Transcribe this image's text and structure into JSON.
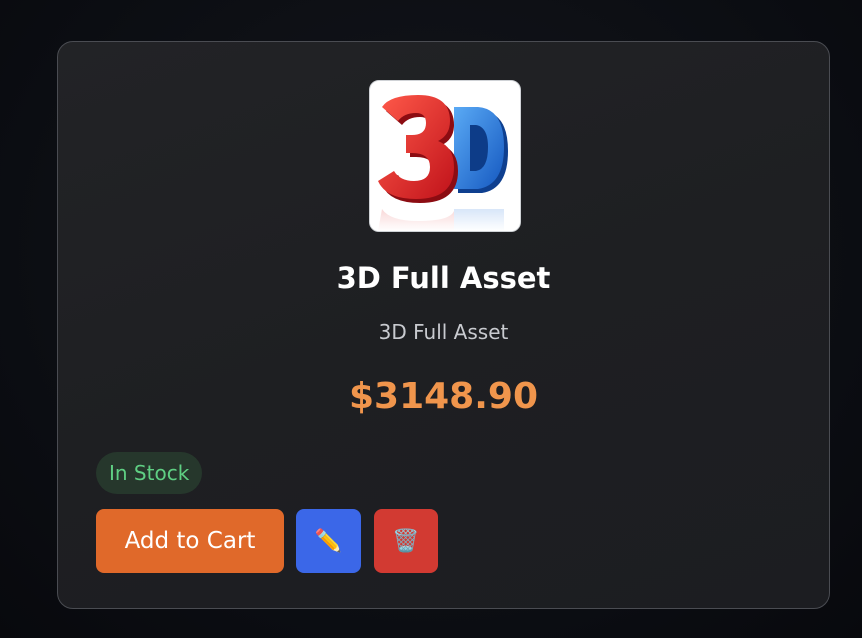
{
  "product": {
    "image_alt": "3D",
    "title": "3D Full Asset",
    "description": "3D Full Asset",
    "price": "$3148.90",
    "stock_status": "In Stock"
  },
  "actions": {
    "add_to_cart_label": "Add to Cart",
    "edit_icon": "✏️",
    "delete_icon": "🗑️"
  },
  "colors": {
    "accent": "#e0692a",
    "price": "#f0954c",
    "edit": "#3b67e8",
    "delete": "#d23a32",
    "stock": "#5fcf83"
  }
}
